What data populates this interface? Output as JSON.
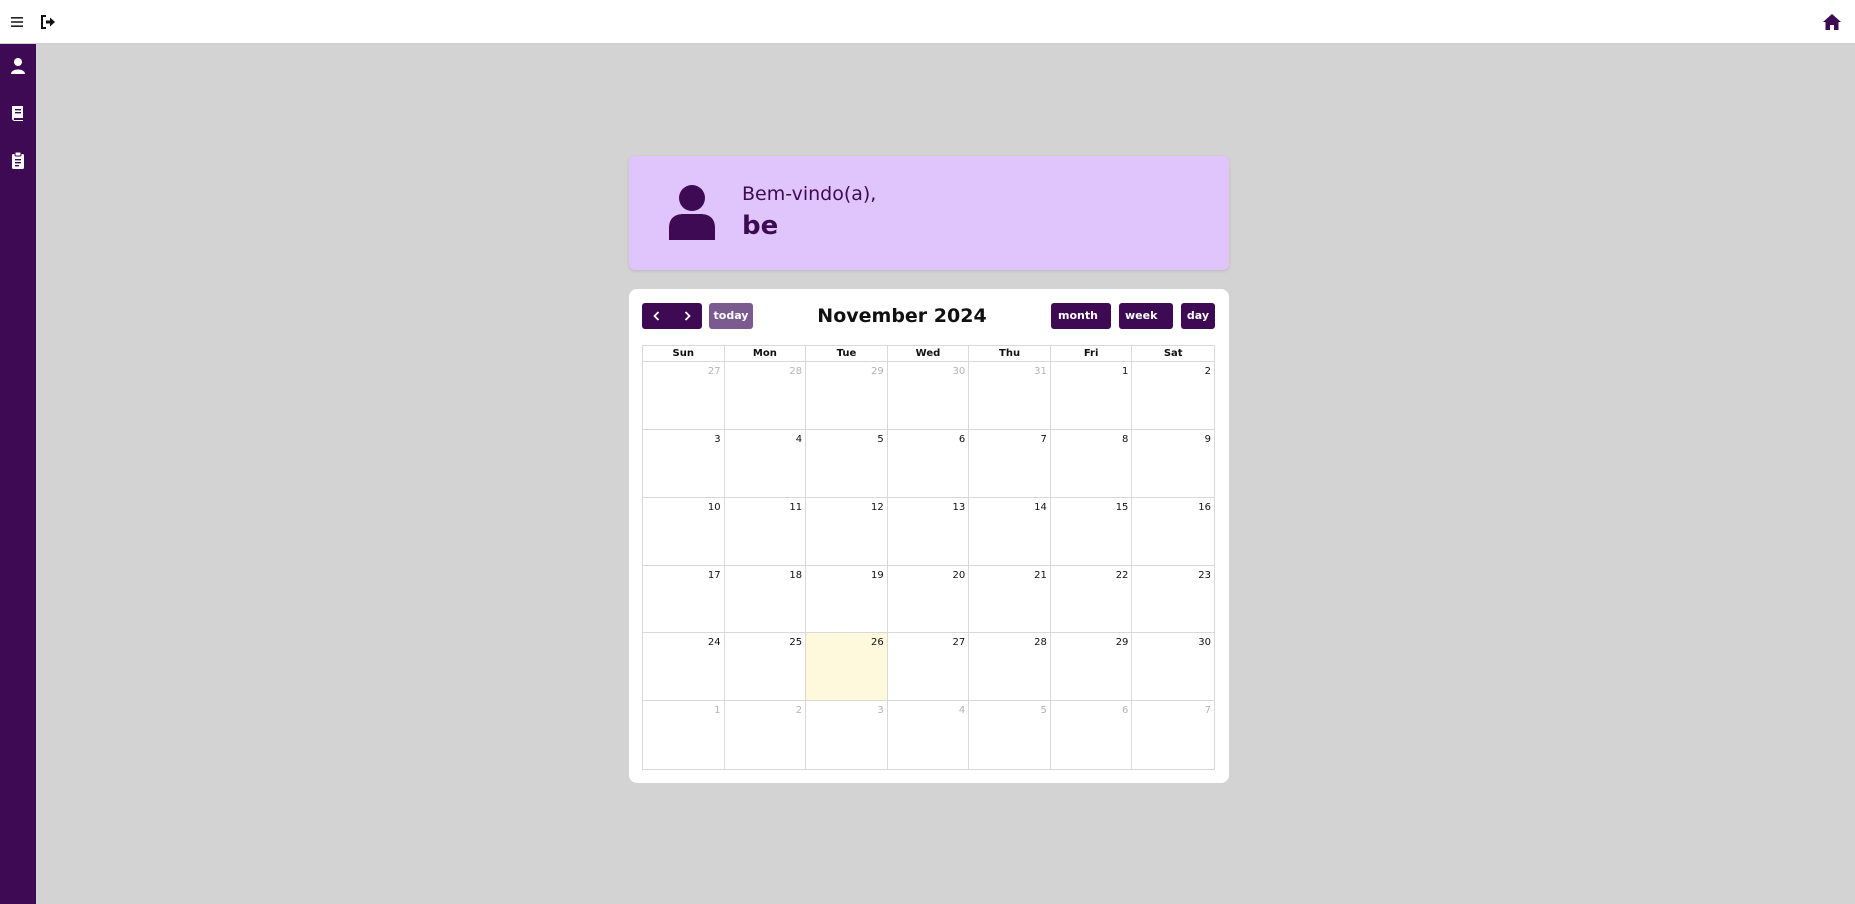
{
  "welcome": {
    "greeting": "Bem-vindo(a),",
    "username": "be"
  },
  "calendar": {
    "title": "November 2024",
    "today_label": "today",
    "views": {
      "month": "month",
      "week": "week",
      "day": "day"
    },
    "weekdays": [
      "Sun",
      "Mon",
      "Tue",
      "Wed",
      "Thu",
      "Fri",
      "Sat"
    ],
    "weeks": [
      [
        {
          "d": "27",
          "other": true
        },
        {
          "d": "28",
          "other": true
        },
        {
          "d": "29",
          "other": true
        },
        {
          "d": "30",
          "other": true
        },
        {
          "d": "31",
          "other": true
        },
        {
          "d": "1"
        },
        {
          "d": "2"
        }
      ],
      [
        {
          "d": "3"
        },
        {
          "d": "4"
        },
        {
          "d": "5"
        },
        {
          "d": "6"
        },
        {
          "d": "7"
        },
        {
          "d": "8"
        },
        {
          "d": "9"
        }
      ],
      [
        {
          "d": "10"
        },
        {
          "d": "11"
        },
        {
          "d": "12"
        },
        {
          "d": "13"
        },
        {
          "d": "14"
        },
        {
          "d": "15"
        },
        {
          "d": "16"
        }
      ],
      [
        {
          "d": "17"
        },
        {
          "d": "18"
        },
        {
          "d": "19"
        },
        {
          "d": "20"
        },
        {
          "d": "21"
        },
        {
          "d": "22"
        },
        {
          "d": "23"
        }
      ],
      [
        {
          "d": "24"
        },
        {
          "d": "25"
        },
        {
          "d": "26",
          "today": true
        },
        {
          "d": "27"
        },
        {
          "d": "28"
        },
        {
          "d": "29"
        },
        {
          "d": "30"
        }
      ],
      [
        {
          "d": "1",
          "other": true
        },
        {
          "d": "2",
          "other": true
        },
        {
          "d": "3",
          "other": true
        },
        {
          "d": "4",
          "other": true
        },
        {
          "d": "5",
          "other": true
        },
        {
          "d": "6",
          "other": true
        },
        {
          "d": "7",
          "other": true
        }
      ]
    ]
  },
  "icons": {
    "menu": "menu-icon",
    "logout": "logout-icon",
    "home": "home-icon",
    "sidebar": [
      "user-icon",
      "book-icon",
      "clipboard-icon"
    ],
    "welcome_avatar": "user-avatar-icon",
    "prev": "chevron-left-icon",
    "next": "chevron-right-icon"
  },
  "colors": {
    "primary": "#3e0a54",
    "today_button": "#7a5a8f",
    "welcome_bg": "#dfc5fb",
    "today_cell": "#fef8dd",
    "page_bg": "#d3d3d3"
  }
}
